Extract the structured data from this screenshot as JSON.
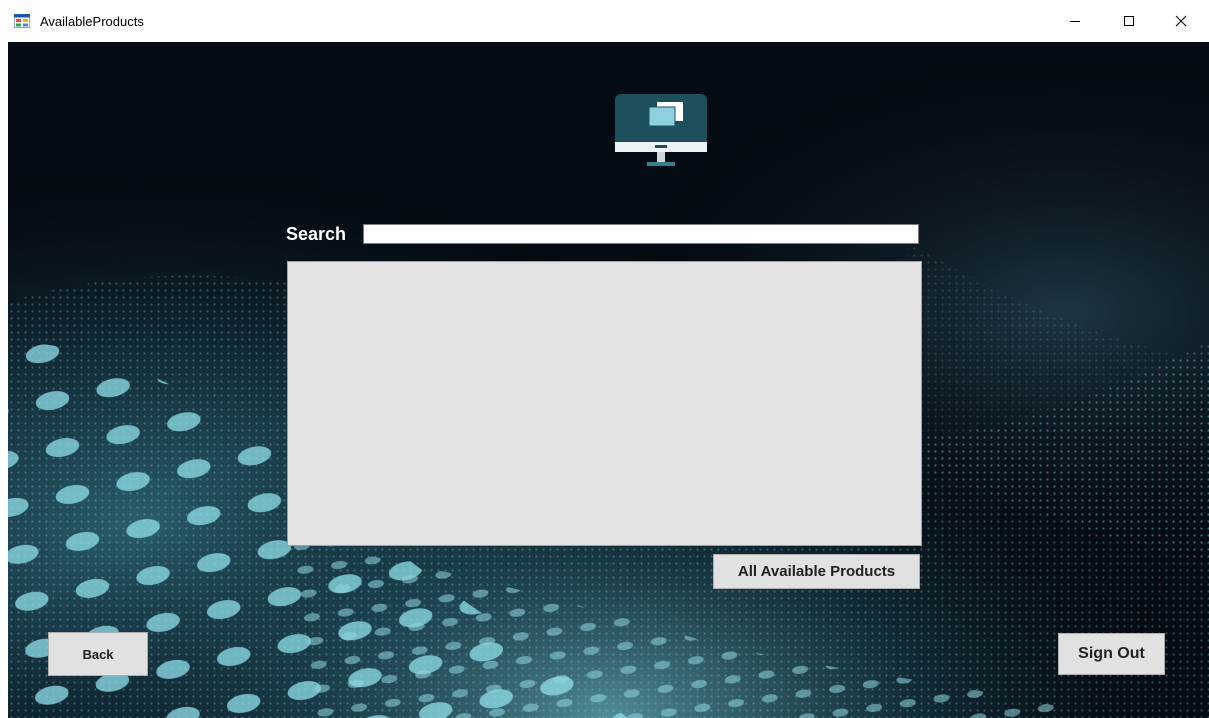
{
  "window": {
    "title": "AvailableProducts",
    "icon": "app-form-icon",
    "controls": [
      "minimize-icon",
      "maximize-icon",
      "close-icon"
    ]
  },
  "header": {
    "icon": "monitor-icon"
  },
  "search": {
    "label": "Search",
    "value": "",
    "placeholder": ""
  },
  "products_list": {
    "items": []
  },
  "buttons": {
    "all_products": "All Available Products",
    "back": "Back",
    "sign_out": "Sign Out"
  },
  "colors": {
    "background": "#050b12",
    "wave": "#5fb8c4",
    "list_background": "#e3e3e3",
    "button_background": "#e1e1e1"
  }
}
